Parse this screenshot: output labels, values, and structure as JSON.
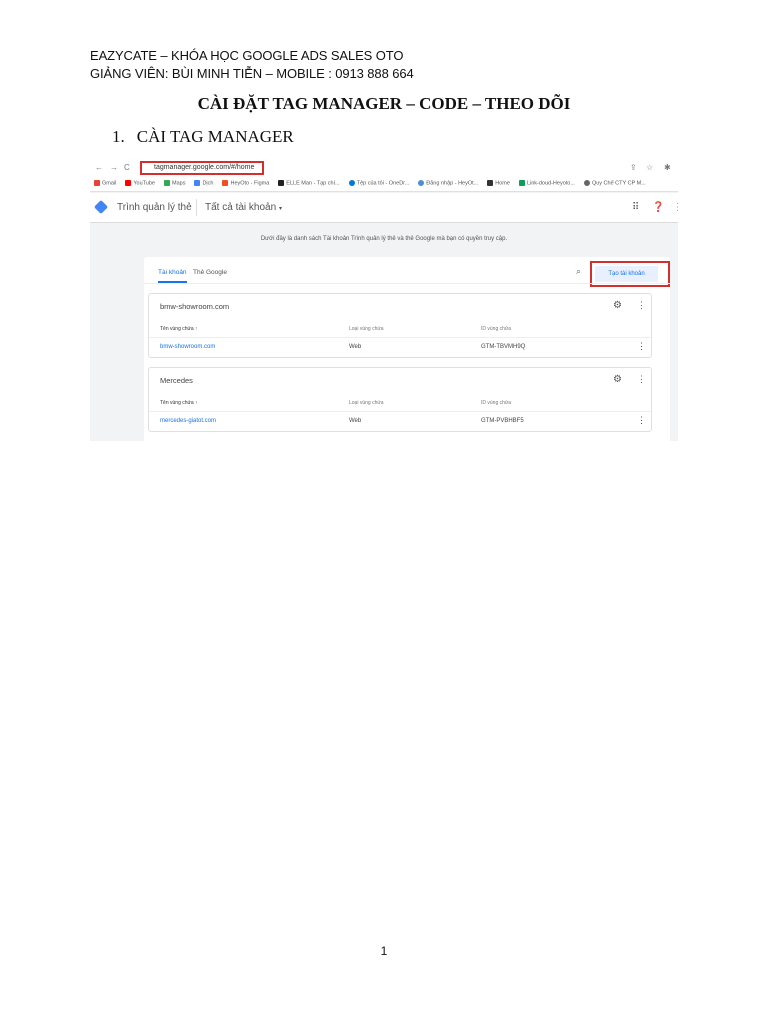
{
  "header": {
    "line1": "EAZYCATE – KHÓA HỌC GOOGLE ADS SALES OTO",
    "line2": "GIẢNG VIÊN: BÙI MINH TIỄN – MOBILE : 0913 888 664"
  },
  "title": "CÀI ĐẶT TAG MANAGER – CODE – THEO DÕI",
  "section": {
    "number": "1.",
    "label": "CÀI TAG MANAGER"
  },
  "browser": {
    "url": "tagmanager.google.com/#/home",
    "bookmarks": [
      "Gmail",
      "YouTube",
      "Maps",
      "Dịch",
      "HeyOto - Figma",
      "ELLE Man - Tạp chí...",
      "Tệp của tôi - OneDr...",
      "Đăng nhập - HeyOt...",
      "Home",
      "Link-doud-Heyoto...",
      "Quy Chế CTY CP M..."
    ]
  },
  "app": {
    "name": "Trình quản lý thẻ",
    "account_selector": "Tất cả tài khoản",
    "intro": "Dưới đây là danh sách Tài khoản Trình quản lý thẻ và thẻ Google mà bạn có quyền truy cập.",
    "tabs": [
      "Tài khoản",
      "Thẻ Google"
    ],
    "create_button": "Tạo tài khoản",
    "columns": [
      "Tên vùng chứa ↑",
      "Loại vùng chứa",
      "ID vùng chứa"
    ],
    "accounts": [
      {
        "name": "bmw-showroom.com",
        "container": "bmw-showroom.com",
        "type": "Web",
        "id": "GTM-TBVMH9Q"
      },
      {
        "name": "Mercedes",
        "container": "mercedes-giatot.com",
        "type": "Web",
        "id": "GTM-PVBHBF5"
      }
    ]
  },
  "page_number": "1"
}
